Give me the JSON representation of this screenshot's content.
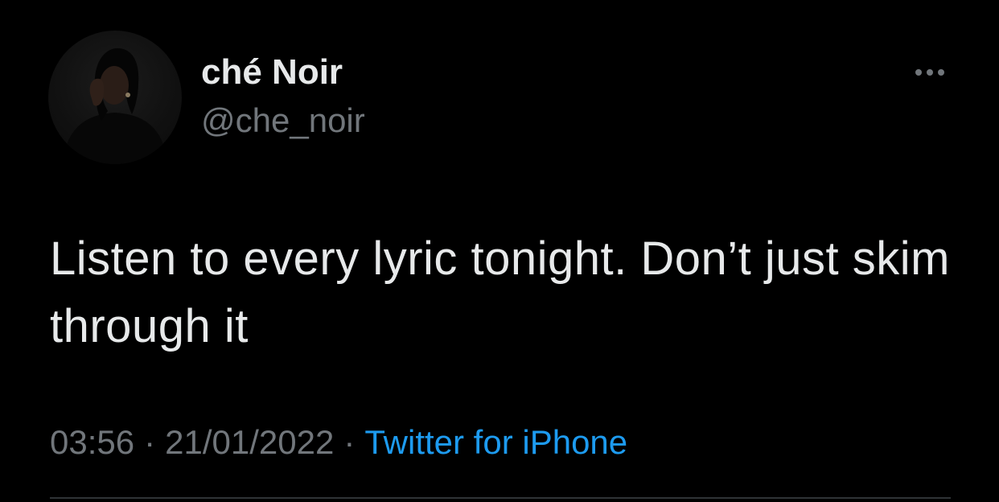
{
  "author": {
    "display_name": "ché Noir",
    "handle": "@che_noir",
    "avatar_icon": "profile-photo"
  },
  "tweet": {
    "text": "Listen to every lyric tonight. Don’t just skim through it"
  },
  "meta": {
    "time": "03:56",
    "separator": "·",
    "date": "21/01/2022",
    "source": "Twitter for iPhone"
  },
  "actions": {
    "more_icon": "more-horizontal-icon"
  },
  "colors": {
    "background": "#000000",
    "primary_text": "#e7e9ea",
    "secondary_text": "#71767b",
    "link": "#1d9bf0",
    "divider": "#2f3336"
  }
}
